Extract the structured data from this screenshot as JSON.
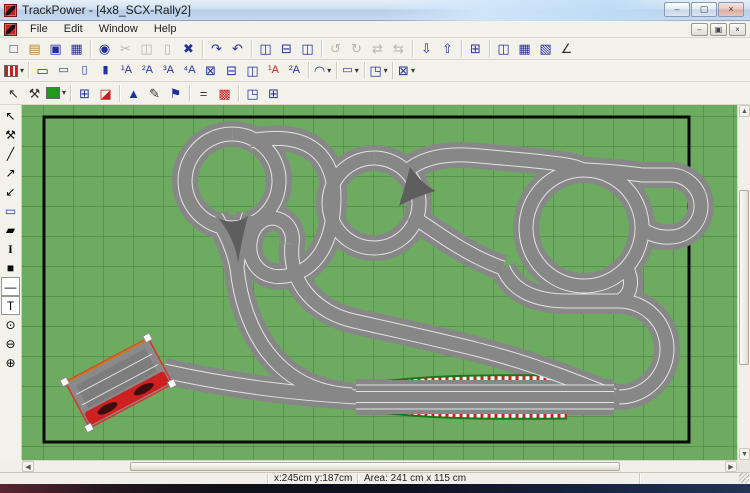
{
  "window": {
    "title": "TrackPower - [4x8_SCX-Rally2]",
    "controls": [
      {
        "name": "minimize-button",
        "glyph": "–"
      },
      {
        "name": "maximize-button",
        "glyph": "▢"
      },
      {
        "name": "close-button",
        "glyph": "×"
      }
    ]
  },
  "menubar": {
    "items": [
      {
        "name": "menu-file",
        "label": "File"
      },
      {
        "name": "menu-edit",
        "label": "Edit"
      },
      {
        "name": "menu-window",
        "label": "Window"
      },
      {
        "name": "menu-help",
        "label": "Help"
      }
    ],
    "mdi_controls": [
      {
        "name": "mdi-minimize-button",
        "glyph": "–"
      },
      {
        "name": "mdi-restore-button",
        "glyph": "▣"
      },
      {
        "name": "mdi-close-button",
        "glyph": "×"
      }
    ]
  },
  "toolbar_standard": [
    {
      "n": "new-file-icon",
      "g": "□"
    },
    {
      "n": "open-file-icon",
      "g": "▤",
      "cls": "amber"
    },
    {
      "n": "save-icon",
      "g": "▣"
    },
    {
      "n": "print-icon",
      "g": "▦"
    },
    {
      "n": "sep"
    },
    {
      "n": "snapshot-icon",
      "g": "◉"
    },
    {
      "n": "cut-icon",
      "g": "✂",
      "cls": "dis"
    },
    {
      "n": "copy-icon",
      "g": "◫",
      "cls": "dis"
    },
    {
      "n": "paste-icon",
      "g": "▯",
      "cls": "dis"
    },
    {
      "n": "delete-icon",
      "g": "✖"
    },
    {
      "n": "sep"
    },
    {
      "n": "redo-icon",
      "g": "↷"
    },
    {
      "n": "undo-icon",
      "g": "↶"
    },
    {
      "n": "sep"
    },
    {
      "n": "cascade-windows-icon",
      "g": "◫"
    },
    {
      "n": "tile-horizontal-icon",
      "g": "⊟"
    },
    {
      "n": "tile-vertical-icon",
      "g": "◫"
    },
    {
      "n": "sep"
    },
    {
      "n": "rotate-left-icon",
      "g": "↺",
      "cls": "dis"
    },
    {
      "n": "rotate-right-icon",
      "g": "↻",
      "cls": "dis"
    },
    {
      "n": "flip-horizontal-icon",
      "g": "⇄",
      "cls": "dis"
    },
    {
      "n": "flip-vertical-icon",
      "g": "⇆",
      "cls": "dis"
    },
    {
      "n": "sep"
    },
    {
      "n": "move-down-icon",
      "g": "⇩"
    },
    {
      "n": "move-up-icon",
      "g": "⇧"
    },
    {
      "n": "sep"
    },
    {
      "n": "piece-list-icon",
      "g": "⊞"
    },
    {
      "n": "sep"
    },
    {
      "n": "parts-list-icon",
      "g": "◫"
    },
    {
      "n": "inventory-icon",
      "g": "▦"
    },
    {
      "n": "report-icon",
      "g": "▧"
    },
    {
      "n": "measure-icon",
      "g": "∠",
      "cls": "dark"
    }
  ],
  "toolbar_pieces": [
    {
      "n": "track-system-selector",
      "swatch": "track-red",
      "dd": true
    },
    {
      "n": "sep"
    },
    {
      "n": "straight-full-icon",
      "g": "▭"
    },
    {
      "n": "straight-half-icon",
      "g": "▭",
      "cls": "small-glyph"
    },
    {
      "n": "straight-quarter-icon",
      "g": "▯",
      "cls": "small-glyph"
    },
    {
      "n": "straight-eighth-icon",
      "g": "▮",
      "cls": "small-glyph"
    },
    {
      "n": "curve-1a-icon",
      "g": "¹A",
      "cls": "small-glyph"
    },
    {
      "n": "curve-2a-icon",
      "g": "²A",
      "cls": "small-glyph"
    },
    {
      "n": "curve-3a-icon",
      "g": "³A",
      "cls": "small-glyph"
    },
    {
      "n": "curve-4a-icon",
      "g": "⁴A",
      "cls": "small-glyph"
    },
    {
      "n": "crossing-icon",
      "g": "⊠"
    },
    {
      "n": "chicane-icon",
      "g": "⊟"
    },
    {
      "n": "lane-change-icon",
      "g": "◫"
    },
    {
      "n": "special-1a-icon",
      "g": "¹A",
      "cls": "small-glyph red"
    },
    {
      "n": "special-2a-icon",
      "g": "²A",
      "cls": "small-glyph"
    },
    {
      "n": "sep"
    },
    {
      "n": "curve-menu",
      "g": "◠",
      "dd": true
    },
    {
      "n": "sep"
    },
    {
      "n": "small-parts-menu",
      "g": "▭",
      "cls": "small-glyph",
      "dd": true
    },
    {
      "n": "sep"
    },
    {
      "n": "border-menu",
      "g": "◳",
      "dd": true
    },
    {
      "n": "sep"
    },
    {
      "n": "crossing-menu",
      "g": "⊠",
      "dd": true
    }
  ],
  "toolbar_edit": [
    {
      "n": "select-tool-icon",
      "g": "↖",
      "cls": "dark"
    },
    {
      "n": "adjust-tool-icon",
      "g": "⚒",
      "cls": "dark"
    },
    {
      "n": "surface-color-picker",
      "swatch": "green",
      "dd": true
    },
    {
      "n": "sep"
    },
    {
      "n": "grid-toggle-icon",
      "g": "⊞"
    },
    {
      "n": "ruler-toggle-icon",
      "g": "◪",
      "cls": "red"
    },
    {
      "n": "sep"
    },
    {
      "n": "elevation-icon",
      "g": "▲"
    },
    {
      "n": "paint-icon",
      "g": "✎",
      "cls": "dark"
    },
    {
      "n": "flag-icon",
      "g": "⚑"
    },
    {
      "n": "sep"
    },
    {
      "n": "lane-lines-icon",
      "g": "=",
      "cls": "dark"
    },
    {
      "n": "start-finish-icon",
      "g": "▩",
      "cls": "red"
    },
    {
      "n": "sep"
    },
    {
      "n": "new-view-icon",
      "g": "◳"
    },
    {
      "n": "fit-view-icon",
      "g": "⊞"
    }
  ],
  "left_tools": [
    {
      "n": "pointer-tool-icon",
      "g": "↖",
      "cls": "blk"
    },
    {
      "n": "wrench-tool-icon",
      "g": "⚒",
      "cls": "blk"
    },
    {
      "n": "line-tool-icon",
      "g": "╱",
      "cls": "blk"
    },
    {
      "n": "arrow-tool-icon",
      "g": "↗",
      "cls": "blk"
    },
    {
      "n": "double-arrow-tool-icon",
      "g": "↙",
      "cls": "blk"
    },
    {
      "n": "rectangle-tool-icon",
      "g": "▭",
      "cls": "blue"
    },
    {
      "n": "eraser-tool-icon",
      "g": "▰",
      "cls": "blk"
    },
    {
      "n": "text-cursor-tool-icon",
      "g": "I",
      "cls": "serif-i blk"
    },
    {
      "n": "fill-color-swatch",
      "g": "■",
      "cls": "blk"
    },
    {
      "n": "line-style-button",
      "g": "—",
      "cls": "blk sunken"
    },
    {
      "n": "text-tool-icon",
      "g": "T",
      "cls": "blk sunken"
    },
    {
      "n": "zoom-reset-icon",
      "g": "⊙",
      "cls": "blk"
    },
    {
      "n": "zoom-out-icon",
      "g": "⊖",
      "cls": "blk"
    },
    {
      "n": "zoom-in-icon",
      "g": "⊕",
      "cls": "blk"
    }
  ],
  "statusbar": {
    "coords": "x:245cm  y:187cm",
    "area": "Area: 241 cm x 115 cm"
  },
  "scrollbar": {
    "up": "▲",
    "down": "▼",
    "left": "◀",
    "right": "▶"
  },
  "colors": {
    "canvas_green": "#6cab60",
    "grid_line": "#4a8544",
    "track_grey": "#878787",
    "lane_white": "#e3e3e3",
    "merge_wedge_grey": "#5e5e5e",
    "selection_red": "#e03030",
    "border_dark_green": "#157a15",
    "rumble_red": "#cc2222",
    "table_outline": "#0a0a0a"
  }
}
